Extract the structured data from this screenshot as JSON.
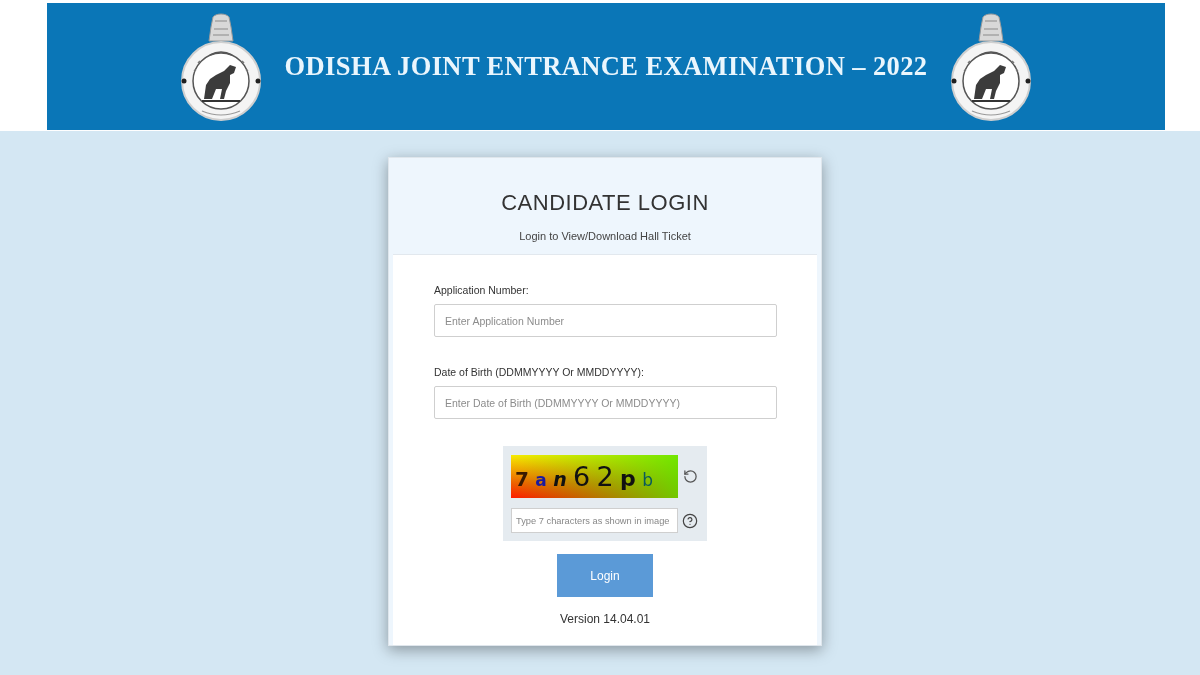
{
  "header": {
    "title": "ODISHA JOINT ENTRANCE EXAMINATION – 2022"
  },
  "login_card": {
    "title": "CANDIDATE LOGIN",
    "subtitle": "Login to View/Download Hall Ticket",
    "fields": [
      {
        "label": "Application Number:",
        "placeholder": "Enter Application Number"
      },
      {
        "label": "Date of Birth (DDMMYYYY Or MMDDYYYY):",
        "placeholder": "Enter Date of Birth (DDMMYYYY Or MMDDYYYY)"
      }
    ],
    "captcha": {
      "image_text": "7 a n 6 2 p b",
      "placeholder": "Type 7 characters as shown in image"
    },
    "button": "Login",
    "version": "Version 14.04.01"
  }
}
